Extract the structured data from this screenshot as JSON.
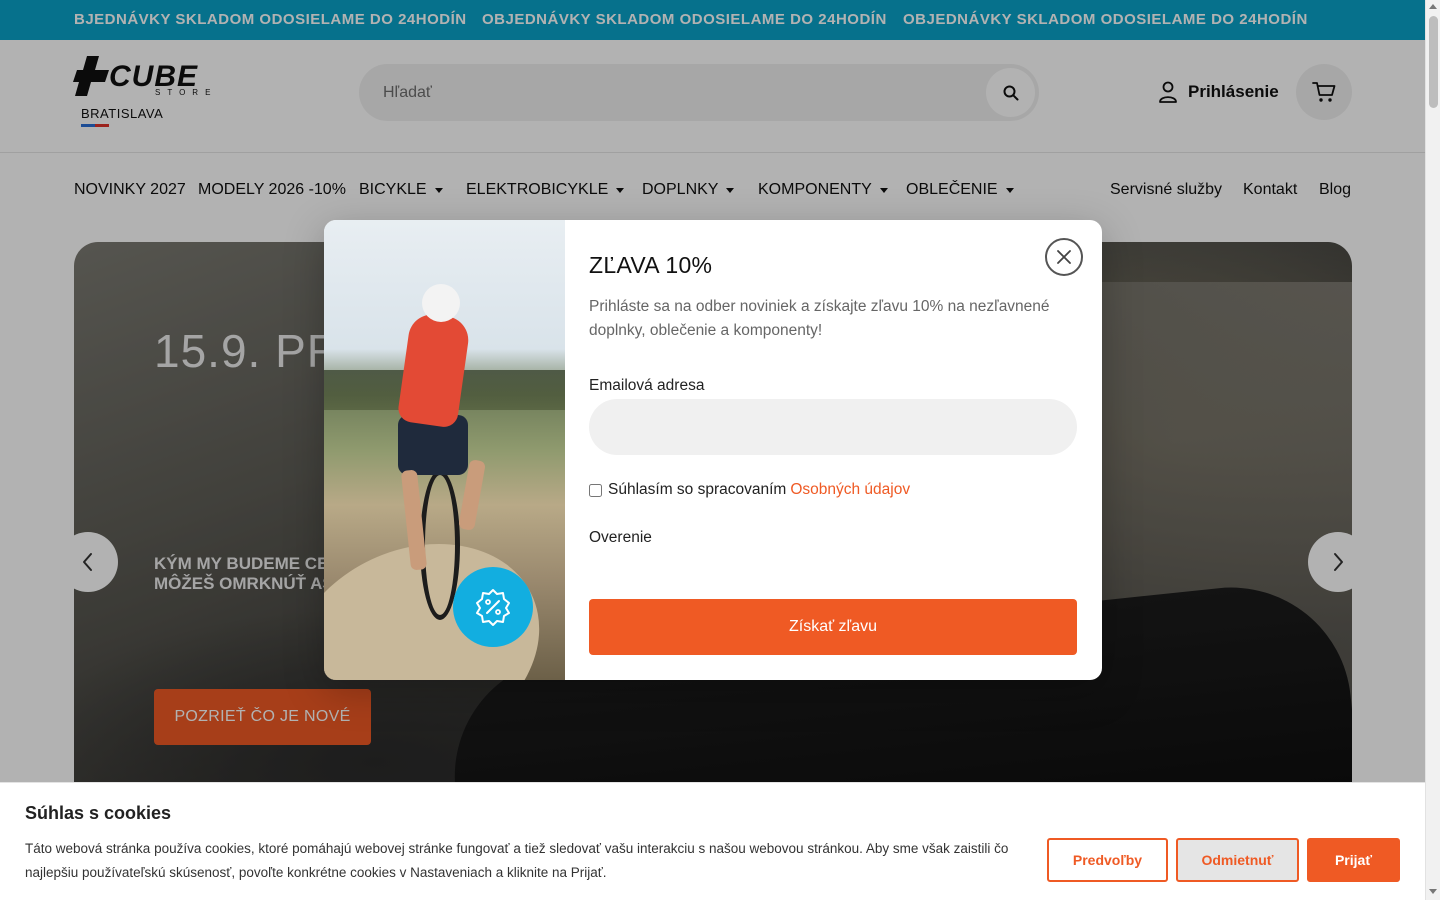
{
  "announcement": {
    "items": [
      "BJEDNÁVKY SKLADOM ODOSIELAME DO 24HODÍN",
      "OBJEDNÁVKY SKLADOM ODOSIELAME DO 24HODÍN",
      "OBJEDNÁVKY SKLADOM ODOSIELAME DO 24HODÍN"
    ]
  },
  "header": {
    "logo_word": "CUBE",
    "logo_sub": "STORE",
    "logo_city": "BRATISLAVA",
    "search_placeholder": "Hľadať",
    "login_label": "Prihlásenie"
  },
  "nav": {
    "items": [
      {
        "label": "NOVINKY 2027"
      },
      {
        "label": "MODELY 2026 -10%"
      },
      {
        "label": "BICYKLE"
      },
      {
        "label": "ELEKTROBICYKLE"
      },
      {
        "label": "DOPLNKY"
      },
      {
        "label": "KOMPONENTY"
      },
      {
        "label": "OBLEČENIE"
      }
    ],
    "secondary": [
      {
        "label": "Servisné služby"
      },
      {
        "label": "Kontakt"
      },
      {
        "label": "Blog"
      }
    ]
  },
  "hero": {
    "title": "15.9. PR",
    "subtitle_line1": "KÝM MY BUDEME CEZ",
    "subtitle_line2": "MÔŽEŠ OMRKNÚŤ ASI",
    "cta": "POZRIEŤ ČO JE NOVÉ"
  },
  "modal": {
    "title": "ZĽAVA 10%",
    "text": "Prihláste sa na odber noviniek a získajte zľavu 10% na nezľavnené doplnky, oblečenie a komponenty!",
    "email_label": "Emailová adresa",
    "email_value": "",
    "consent_text": "Súhlasím so spracovaním",
    "consent_link": "Osobných údajov",
    "verify_label": "Overenie",
    "submit_label": "Získať zľavu"
  },
  "cookie": {
    "title": "Súhlas s cookies",
    "text": "Táto webová stránka používa cookies, ktoré pomáhajú webovej stránke fungovať a tiež sledovať vašu interakciu s našou webovou stránkou. Aby sme však zaistili čo najlepšiu používateľskú skúsenosť, povoľte konkrétne cookies v Nastaveniach a kliknite na Prijať.",
    "btn_prefs": "Predvoľby",
    "btn_reject": "Odmietnuť",
    "btn_accept": "Prijať"
  },
  "colors": {
    "accent": "#ef5a24",
    "announcement_bg": "#0aa3c9",
    "badge": "#12aee0"
  },
  "icons": [
    "search-icon",
    "user-icon",
    "cart-icon",
    "chevron-left-icon",
    "chevron-right-icon",
    "close-icon",
    "discount-icon"
  ]
}
